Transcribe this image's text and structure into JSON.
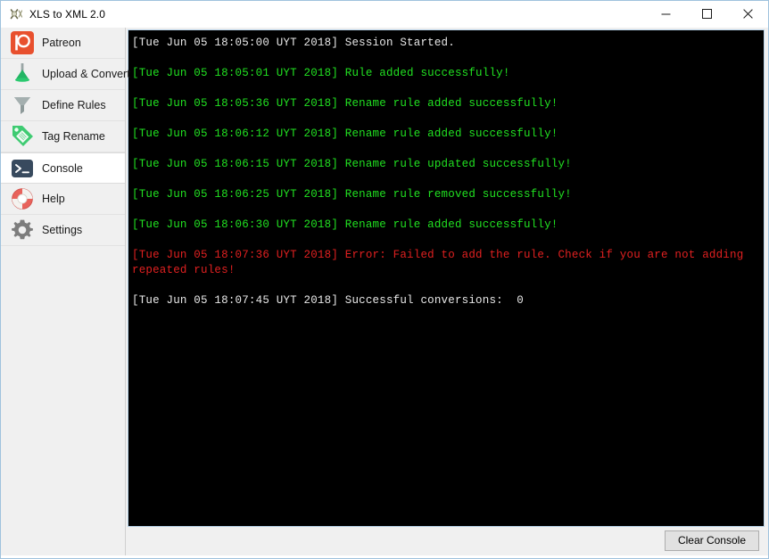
{
  "window": {
    "title": "XLS to XML 2.0",
    "icon": "app-icon",
    "controls": {
      "minimize": "—",
      "maximize": "□",
      "close": "✕"
    }
  },
  "sidebar": {
    "items": [
      {
        "label": "Patreon",
        "icon": "patreon-icon",
        "selected": false
      },
      {
        "label": "Upload & Convert",
        "icon": "funnel-up-icon",
        "selected": false
      },
      {
        "label": "Define Rules",
        "icon": "funnel-icon",
        "selected": false
      },
      {
        "label": "Tag Rename",
        "icon": "tag-icon",
        "selected": false
      },
      {
        "label": "Console",
        "icon": "terminal-icon",
        "selected": true
      },
      {
        "label": "Help",
        "icon": "lifebuoy-icon",
        "selected": false
      },
      {
        "label": "Settings",
        "icon": "gear-icon",
        "selected": false
      }
    ]
  },
  "console": {
    "colors": {
      "background": "#000000",
      "info": "#e8e8e8",
      "success": "#21e021",
      "error": "#e02020"
    },
    "lines": [
      {
        "text": "[Tue Jun 05 18:05:00 UYT 2018] Session Started.",
        "level": "info"
      },
      {
        "text": "[Tue Jun 05 18:05:01 UYT 2018] Rule added successfully!",
        "level": "success"
      },
      {
        "text": "[Tue Jun 05 18:05:36 UYT 2018] Rename rule added successfully!",
        "level": "success"
      },
      {
        "text": "[Tue Jun 05 18:06:12 UYT 2018] Rename rule added successfully!",
        "level": "success"
      },
      {
        "text": "[Tue Jun 05 18:06:15 UYT 2018] Rename rule updated successfully!",
        "level": "success"
      },
      {
        "text": "[Tue Jun 05 18:06:25 UYT 2018] Rename rule removed successfully!",
        "level": "success"
      },
      {
        "text": "[Tue Jun 05 18:06:30 UYT 2018] Rename rule added successfully!",
        "level": "success"
      },
      {
        "text": "[Tue Jun 05 18:07:36 UYT 2018] Error: Failed to add the rule. Check if you are not adding repeated rules!",
        "level": "error"
      },
      {
        "text": "[Tue Jun 05 18:07:45 UYT 2018] Successful conversions:  0",
        "level": "info"
      }
    ]
  },
  "statusbar": {
    "clear_label": "Clear Console"
  }
}
